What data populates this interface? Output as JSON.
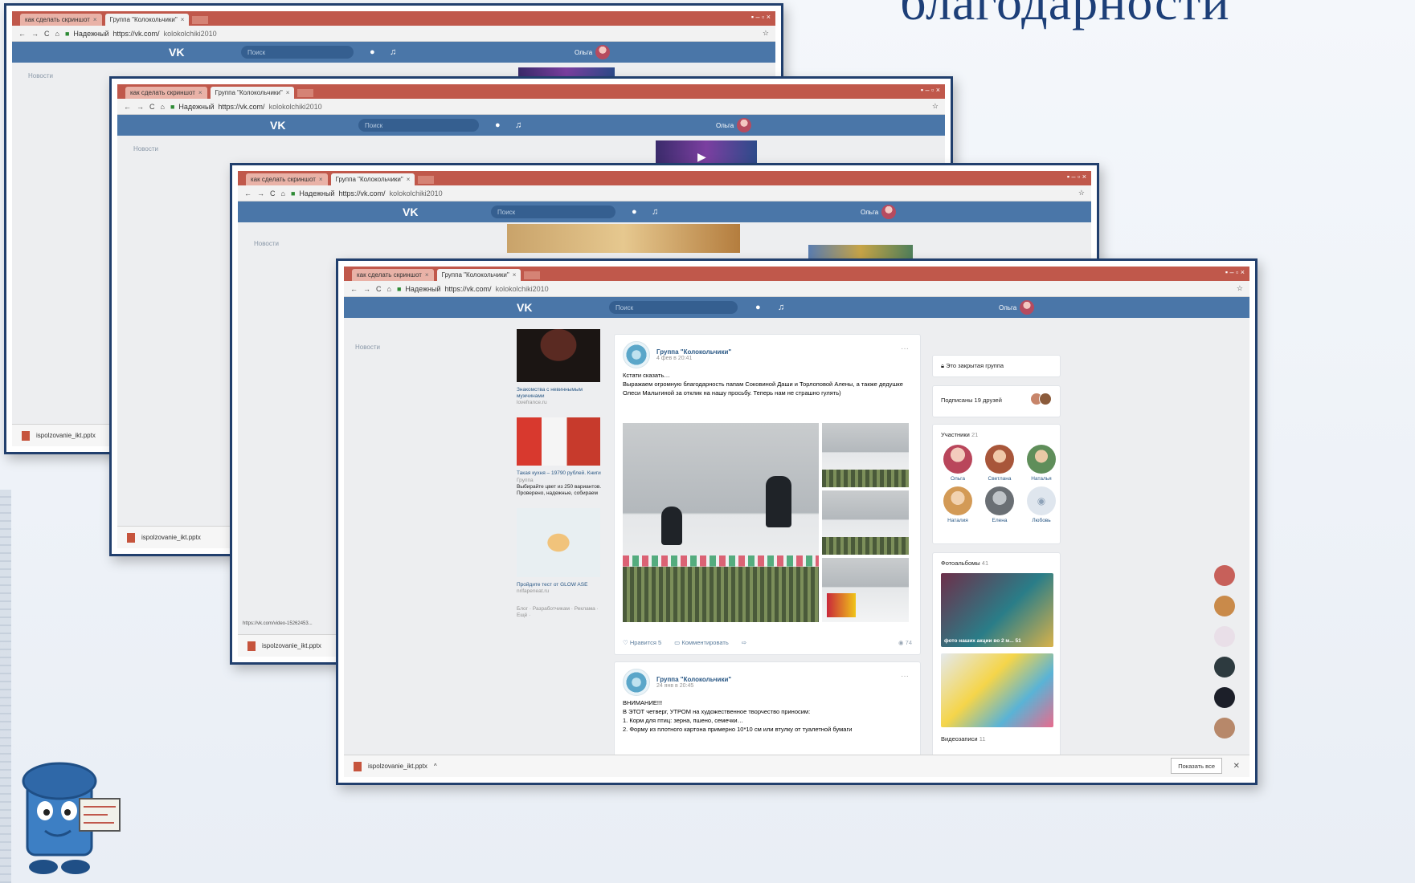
{
  "slide": {
    "title": "благодарности"
  },
  "browser": {
    "tab1": "как сделать скриншот",
    "tab2": "Группа \"Колокольчики\"",
    "tab_close": "×",
    "secure_label": "Надежный",
    "url_prefix": "https://vk.com/",
    "url_rest": "kolokolchiki2010",
    "win_controls": "▪ – ▫ ×",
    "star": "☆"
  },
  "vk": {
    "logo": "VK",
    "search_placeholder": "Поиск",
    "user_name": "Ольга",
    "menu_news": "Новости"
  },
  "download": {
    "file_name": "ispolzovanie_ikt.pptx",
    "show_all": "Показать все",
    "close": "✕"
  },
  "status_url": "https://vk.com/video-15262453...",
  "ads": [
    {
      "title": "Знакомства с невиннымым мужчинами",
      "source": "lovefrance.ru"
    },
    {
      "title": "Такая кухня – 19790 рублей. Книги",
      "source": "Группа",
      "text": "Выбирайте цвет из 250 вариантов. Проверено, надежные, собираем"
    },
    {
      "title": "Пройдите тест от GLOW ASE",
      "source": "nrifapeneat.ru"
    }
  ],
  "footer_links": "Блог · Разработчикам · Реклама · Ещё ·",
  "post1": {
    "group": "Группа \"Колокольчики\"",
    "date": "4 фев в 20:41",
    "text": "Кстати сказать…\nВыражаем огромную благодарность папам Соковиной Даши и Торлоповой Алены, а также дедушке Олеси Малыгиной за отклик на нашу просьбу. Теперь нам не страшно гулять)",
    "like": "Нравится  5",
    "comment": "Комментировать",
    "views": "74"
  },
  "post2": {
    "group": "Группа \"Колокольчики\"",
    "date": "24 янв в 20:45",
    "text": "ВНИМАНИЕ!!!\nВ ЭТОТ четверг, УТРОМ на художественное творчество приносим:\n1. Корм для птиц: зерна, пшено, семечки…\n2. Форму из плотного картона примерно 10*10 см или втулку от туалетной бумаги"
  },
  "sidebar": {
    "closed_group": "Это закрытая группа",
    "subscribed": "Подписаны 19 друзей",
    "members_title": "Участники",
    "members_count": "21",
    "members": [
      "Ольга",
      "Светлана",
      "Наталья",
      "Наталия",
      "Елена",
      "Любовь"
    ],
    "albums_title": "Фотоальбомы",
    "albums_count": "41",
    "album1": "фото наших акции во 2 м... 51",
    "album2": "",
    "videos_title": "Видеозаписи",
    "videos_count": "11"
  },
  "colors": {
    "vk_blue": "#4a76a8",
    "chrome_red": "#c0584b",
    "frame_blue": "#2a4f87"
  }
}
